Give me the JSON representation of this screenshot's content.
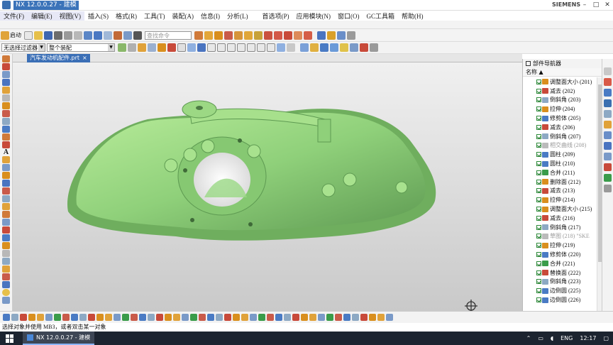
{
  "window": {
    "title": "NX 12.0.0.27 - 建模",
    "brand": "SIEMENS"
  },
  "menu": [
    "文件(F)",
    "编辑(E)",
    "视图(V)",
    "插入(S)",
    "格式(R)",
    "工具(T)",
    "装配(A)",
    "信息(I)",
    "分析(L)",
    "首选项(P)",
    "应用模块(N)",
    "窗口(O)",
    "GC工具箱",
    "帮助(H)"
  ],
  "toolbar": {
    "start_label": "启动",
    "search_placeholder": "查找命令",
    "filter_value": "无选择过滤器",
    "assembly_value": "整个装配"
  },
  "tab": {
    "label": "汽车发动机配件.prt",
    "close": "×"
  },
  "navigator": {
    "title": "部件导航器",
    "column": "名称",
    "items": [
      {
        "label": "调整面大小 (201)",
        "color": "#d98f1e"
      },
      {
        "label": "减去 (202)",
        "color": "#c84a3a"
      },
      {
        "label": "倒斜角 (203)",
        "color": "#8da9c4"
      },
      {
        "label": "拉伸 (204)",
        "color": "#d98f1e"
      },
      {
        "label": "修剪体 (205)",
        "color": "#4a7bc4"
      },
      {
        "label": "减去 (206)",
        "color": "#c84a3a"
      },
      {
        "label": "倒斜角 (207)",
        "color": "#8da9c4"
      },
      {
        "label": "相交曲线 (208)",
        "color": "#bbbbbb",
        "dim": true
      },
      {
        "label": "圆柱 (209)",
        "color": "#4a7bc4"
      },
      {
        "label": "圆柱 (210)",
        "color": "#4a7bc4"
      },
      {
        "label": "合并 (211)",
        "color": "#3a9c4a"
      },
      {
        "label": "删除面 (212)",
        "color": "#d98f1e"
      },
      {
        "label": "减去 (213)",
        "color": "#c84a3a"
      },
      {
        "label": "拉伸 (214)",
        "color": "#d98f1e"
      },
      {
        "label": "调整面大小 (215)",
        "color": "#d98f1e"
      },
      {
        "label": "减去 (216)",
        "color": "#c84a3a"
      },
      {
        "label": "倒斜角 (217)",
        "color": "#8da9c4"
      },
      {
        "label": "草图 (218) \"SKE",
        "color": "#bbbbbb",
        "dim": true
      },
      {
        "label": "拉伸 (219)",
        "color": "#d98f1e"
      },
      {
        "label": "修剪体 (220)",
        "color": "#4a7bc4"
      },
      {
        "label": "合并 (221)",
        "color": "#3a9c4a"
      },
      {
        "label": "替换面 (222)",
        "color": "#c84a3a"
      },
      {
        "label": "倒斜角 (223)",
        "color": "#8da9c4"
      },
      {
        "label": "边倒圆 (225)",
        "color": "#4a7bc4"
      },
      {
        "label": "边倒圆 (226)",
        "color": "#4a7bc4"
      }
    ]
  },
  "status": "选择对象并使用 MB3，或者双击某一对象",
  "taskbar": {
    "app": "NX 12.0.0.27 - 建模",
    "lang": "ENG",
    "time": "12:17"
  },
  "colors": {
    "accent": "#3b6fb6",
    "model": "#8fd07a"
  }
}
